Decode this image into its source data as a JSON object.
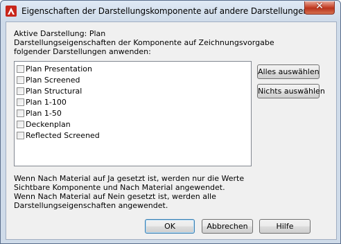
{
  "window": {
    "title": "Eigenschaften der Darstellungskomponente auf andere Darstellungen anw...",
    "close_label": "✕"
  },
  "active_display": {
    "label": "Aktive Darstellung:",
    "value": "Plan"
  },
  "description": [
    "Darstellungseigenschaften der Komponente auf Zeichnungsvorgabe",
    "folgender Darstellungen anwenden:"
  ],
  "list": {
    "items": [
      {
        "label": "Plan Presentation",
        "checked": false
      },
      {
        "label": "Plan Screened",
        "checked": false
      },
      {
        "label": "Plan Structural",
        "checked": false
      },
      {
        "label": "Plan 1-100",
        "checked": false
      },
      {
        "label": "Plan 1-50",
        "checked": false
      },
      {
        "label": "Deckenplan",
        "checked": false
      },
      {
        "label": "Reflected Screened",
        "checked": false
      }
    ]
  },
  "side_buttons": {
    "select_all": "Alles auswählen",
    "select_none": "Nichts auswählen"
  },
  "info": [
    "Wenn Nach Material auf Ja gesetzt ist, werden nur die Werte",
    "Sichtbare Komponente und Nach Material angewendet.",
    "Wenn Nach Material auf Nein gesetzt ist, werden alle",
    "Darstellungseigenschaften angewendet."
  ],
  "footer": {
    "ok": "OK",
    "cancel": "Abbrechen",
    "help": "Hilfe"
  }
}
